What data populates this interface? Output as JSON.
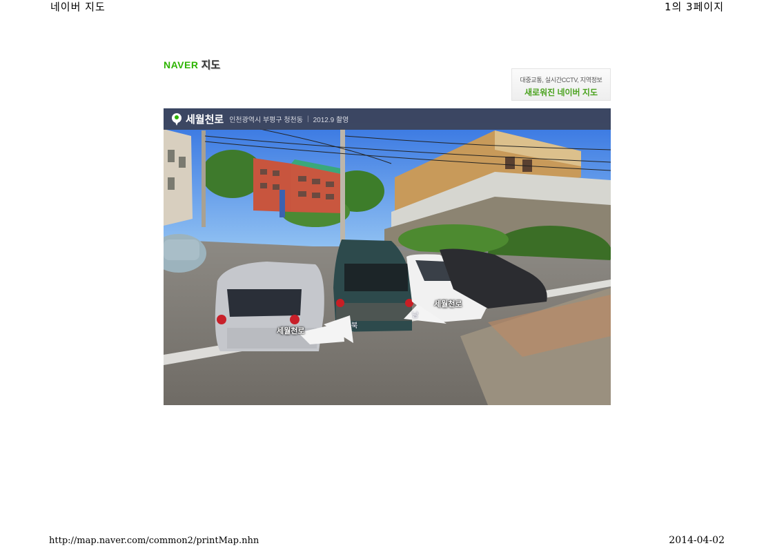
{
  "header": {
    "left": "네이버 지도",
    "right": "1의 3페이지"
  },
  "footer": {
    "url": "http://map.naver.com/common2/printMap.nhn",
    "date": "2014-04-02"
  },
  "logo": {
    "brand": "NAVER",
    "product": "지도"
  },
  "promo": {
    "line1": "대중교통, 실시간CCTV, 지역정보",
    "line2": "새로워진 네이버 지도"
  },
  "street_view": {
    "road_name": "세월천로",
    "address": "인천광역시 부평구 청천동",
    "photo_date": "2012.9 촬영",
    "nav_labels": {
      "left_road": "세월천로",
      "right_road": "세월천로",
      "north": "북",
      "south": "남"
    }
  },
  "colors": {
    "brand_green": "#2db400",
    "bar_bg": "#3c4050"
  },
  "icons": [
    "location-pin-icon",
    "direction-arrow-icon"
  ]
}
